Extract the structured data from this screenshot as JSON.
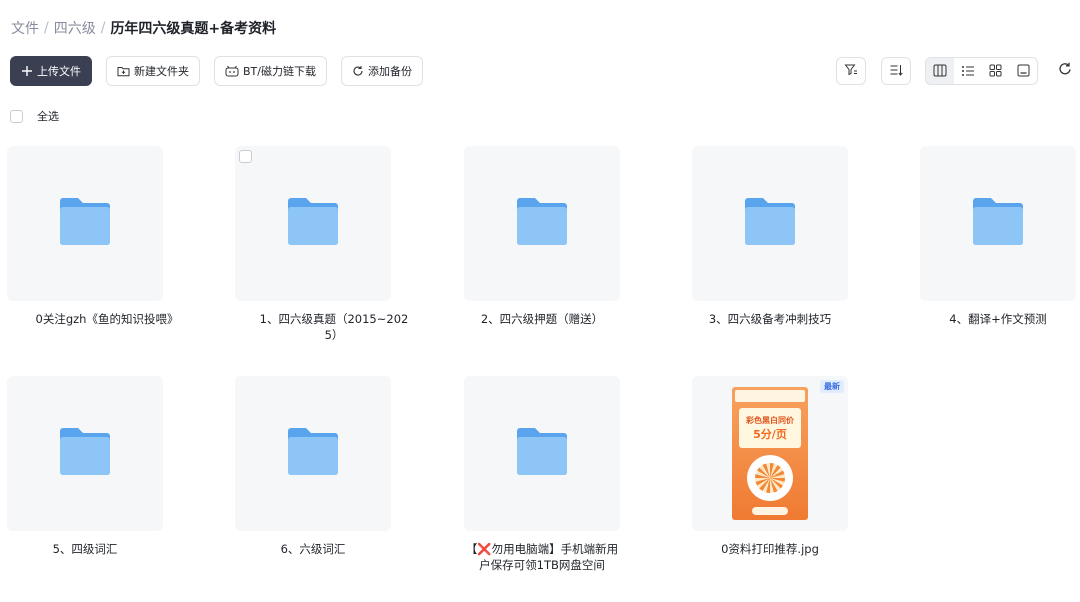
{
  "breadcrumb": {
    "items": [
      "文件",
      "四六级"
    ],
    "separator": "/",
    "current": "历年四六级真题+备考资料"
  },
  "toolbar": {
    "upload_label": "上传文件",
    "new_folder_label": "新建文件夹",
    "bt_label": "BT/磁力链下载",
    "backup_label": "添加备份"
  },
  "select_all_label": "全选",
  "items": [
    {
      "name": "0关注gzh《鱼的知识投喂》",
      "type": "folder"
    },
    {
      "name": "1、四六级真题（2015~2025）",
      "type": "folder"
    },
    {
      "name": "2、四六级押题（赠送）",
      "type": "folder"
    },
    {
      "name": "3、四六级备考冲刺技巧",
      "type": "folder"
    },
    {
      "name": "4、翻译+作文预测",
      "type": "folder"
    },
    {
      "name": "5、四级词汇",
      "type": "folder"
    },
    {
      "name": "6、六级词汇",
      "type": "folder"
    },
    {
      "name": "【❌勿用电脑端】手机端新用户保存可领1TB网盘空间",
      "type": "folder"
    },
    {
      "name": "0资料打印推荐.jpg",
      "type": "image",
      "badge": "最新",
      "poster": {
        "title": "彩色黑白同价",
        "price": "5分/页"
      }
    }
  ],
  "colors": {
    "primary_button": "#3a3f52",
    "folder_light": "#8ec5f7",
    "folder_dark": "#5aa4ee",
    "badge_bg": "#e0ecff"
  }
}
